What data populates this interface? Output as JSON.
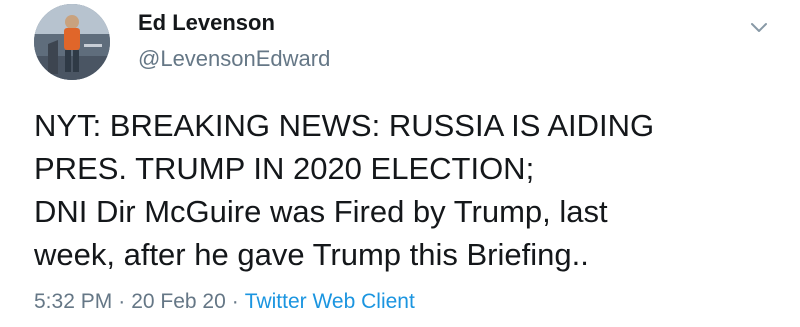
{
  "author": {
    "display_name": "Ed Levenson",
    "handle": "@LevensonEdward"
  },
  "tweet": {
    "lines": [
      "NYT: BREAKING NEWS: RUSSIA IS AIDING",
      "PRES. TRUMP IN 2020 ELECTION;",
      "DNI Dir McGuire was Fired by Trump, last",
      "week, after he gave Trump this Briefing.."
    ]
  },
  "meta": {
    "time": "5:32 PM",
    "separator": "·",
    "date": "20 Feb 20",
    "source": "Twitter Web Client"
  },
  "icons": {
    "menu": "chevron-down-icon",
    "avatar": "profile-photo"
  },
  "colors": {
    "text": "#14171a",
    "secondary": "#657786",
    "link": "#1b95e0"
  }
}
